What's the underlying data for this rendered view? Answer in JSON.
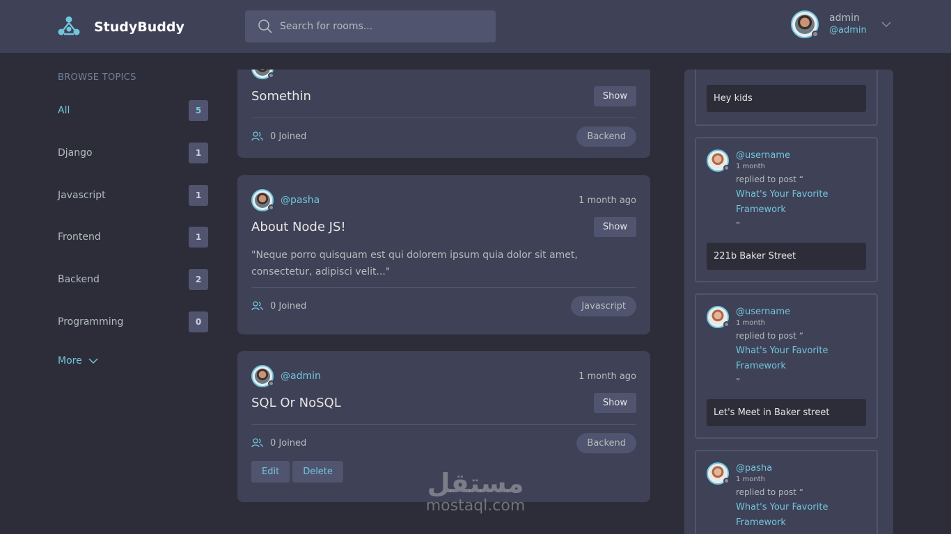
{
  "header": {
    "brand": "StudyBuddy",
    "search_placeholder": "Search for rooms...",
    "user": {
      "name": "admin",
      "handle": "@admin"
    }
  },
  "sidebar": {
    "title": "BROWSE TOPICS",
    "topics": [
      {
        "label": "All",
        "count": "5"
      },
      {
        "label": "Django",
        "count": "1"
      },
      {
        "label": "Javascript",
        "count": "1"
      },
      {
        "label": "Frontend",
        "count": "1"
      },
      {
        "label": "Backend",
        "count": "2"
      },
      {
        "label": "Programming",
        "count": "0"
      }
    ],
    "more_label": "More"
  },
  "rooms": [
    {
      "title": "Somethin",
      "show_label": "Show",
      "joined": "0 Joined",
      "topic": "Backend"
    },
    {
      "host": "@pasha",
      "time": "1 month ago",
      "title": "About Node JS!",
      "show_label": "Show",
      "description": "\"Neque porro quisquam est qui dolorem ipsum quia dolor sit amet, consectetur, adipisci velit...\"",
      "joined": "0 Joined",
      "topic": "Javascript"
    },
    {
      "host": "@admin",
      "time": "1 month ago",
      "title": "SQL Or NoSQL",
      "show_label": "Show",
      "joined": "0 Joined",
      "topic": "Backend",
      "edit_label": "Edit",
      "delete_label": "Delete"
    }
  ],
  "activity": [
    {
      "message": "Hey kids"
    },
    {
      "user": "@username",
      "time": "1 month",
      "action": "replied to post “",
      "post_line1": "What's Your Favorite",
      "post_line2": "Framework",
      "close": "”",
      "message": "221b Baker Street"
    },
    {
      "user": "@username",
      "time": "1 month",
      "action": "replied to post “",
      "post_line1": "What's Your Favorite",
      "post_line2": "Framework",
      "close": "”",
      "message": "Let's Meet in Baker street"
    },
    {
      "user": "@pasha",
      "time": "1 month",
      "action": "replied to post “",
      "post_line1": "What's Your Favorite",
      "post_line2": "Framework"
    }
  ],
  "watermark": {
    "arabic": "مستقل",
    "latin": "mostaql.com"
  },
  "colors": {
    "accent": "#71c6dd",
    "background": "#2d2d39",
    "panel": "#3f4156",
    "control": "#51546e"
  }
}
